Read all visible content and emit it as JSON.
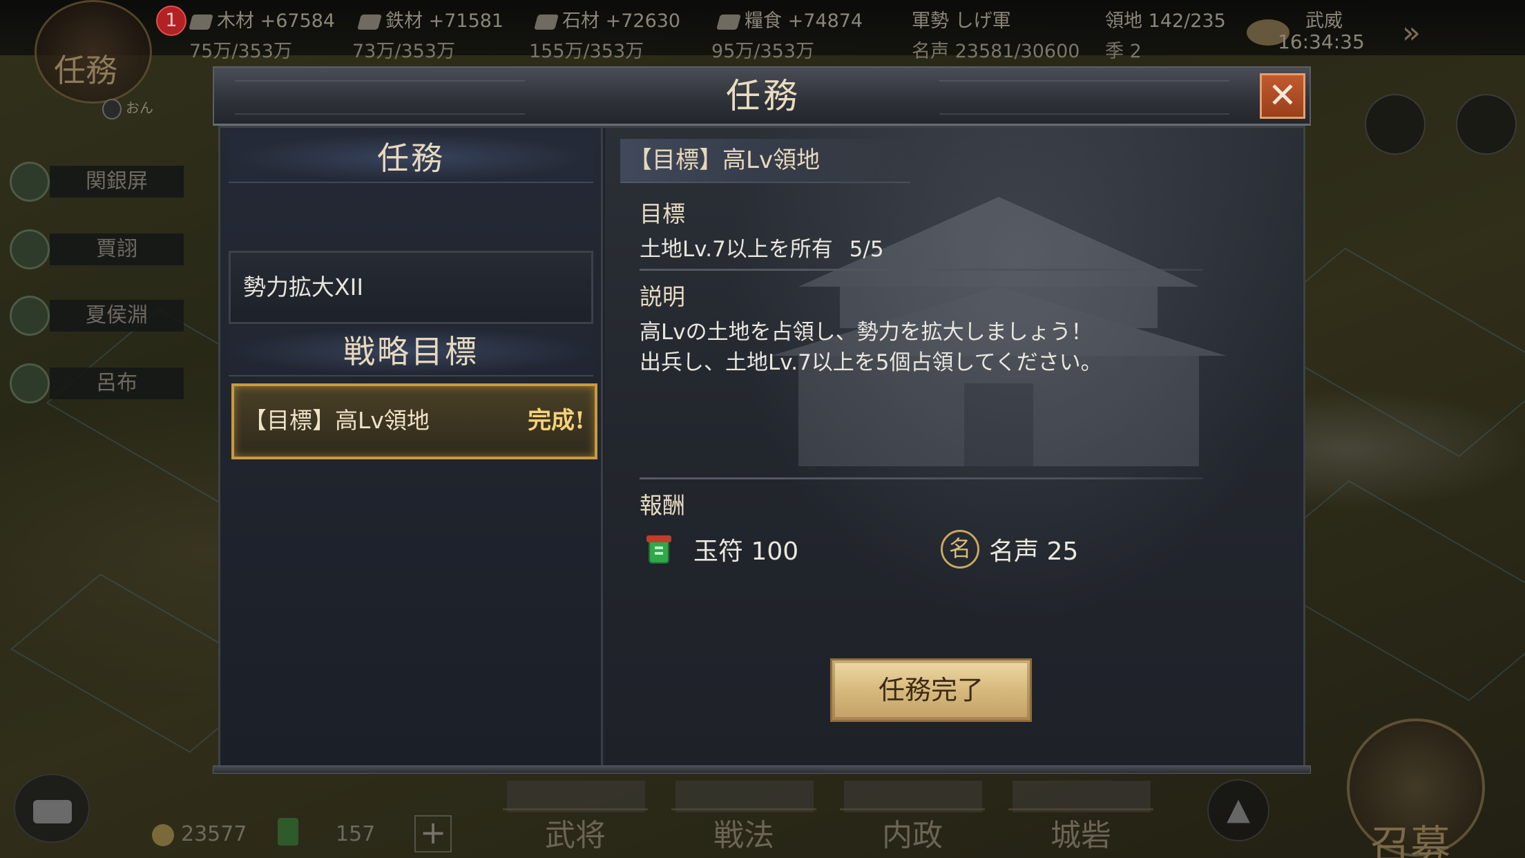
{
  "top_bar": {
    "resources": [
      {
        "icon": "wood-icon",
        "name": "木材",
        "delta": "+67584",
        "amount": "75万/353万"
      },
      {
        "icon": "iron-icon",
        "name": "鉄材",
        "delta": "+71581",
        "amount": "73万/353万"
      },
      {
        "icon": "stone-icon",
        "name": "石材",
        "delta": "+72630",
        "amount": "155万/353万"
      },
      {
        "icon": "grain-icon",
        "name": "糧食",
        "delta": "+74874",
        "amount": "95万/353万"
      }
    ],
    "faction": "軍勢 しげ軍",
    "fame": "名声 23581/30600",
    "season": "季 2",
    "territory": "領地 142/235",
    "prestige": "武威",
    "time": "16:34:35",
    "quest_emblem": {
      "label": "任務",
      "badge": "1",
      "sub": "おん"
    }
  },
  "side_list": [
    "関銀屏",
    "賈詡",
    "夏侯淵",
    "呂布"
  ],
  "bottom_bar": {
    "gold": "23577",
    "jade": "157",
    "plus": "+",
    "tabs": [
      "武将",
      "戦法",
      "内政",
      "城砦"
    ],
    "recruit": "召募"
  },
  "modal": {
    "title": "任務",
    "close": "✕",
    "left": {
      "task_heading": "任務",
      "task_name": "勢力拡大XII",
      "strategy_heading": "戦略目標",
      "selected_item": {
        "label": "【目標】高Lv領地",
        "status": "完成!"
      }
    },
    "right": {
      "objective_header": "【目標】高Lv領地",
      "goal_label": "目標",
      "goal_text": "土地Lv.7以上を所有",
      "goal_progress": "5/5",
      "desc_label": "説明",
      "desc_line1": "高Lvの土地を占領し、勢力を拡大しましょう！",
      "desc_line2": "出兵し、土地Lv.7以上を5個占領してください。",
      "reward_label": "報酬",
      "rewards": [
        {
          "icon": "jade-talisman-icon",
          "text": "玉符 100"
        },
        {
          "icon": "fame-icon",
          "icon_glyph": "名",
          "text": "名声 25"
        }
      ],
      "complete_button": "任務完了"
    }
  },
  "colors": {
    "accent_gold": "#c99a3f",
    "close_button": "#c25a2d",
    "complete_button": "#d6b97d",
    "panel_bg": "#20242c"
  }
}
